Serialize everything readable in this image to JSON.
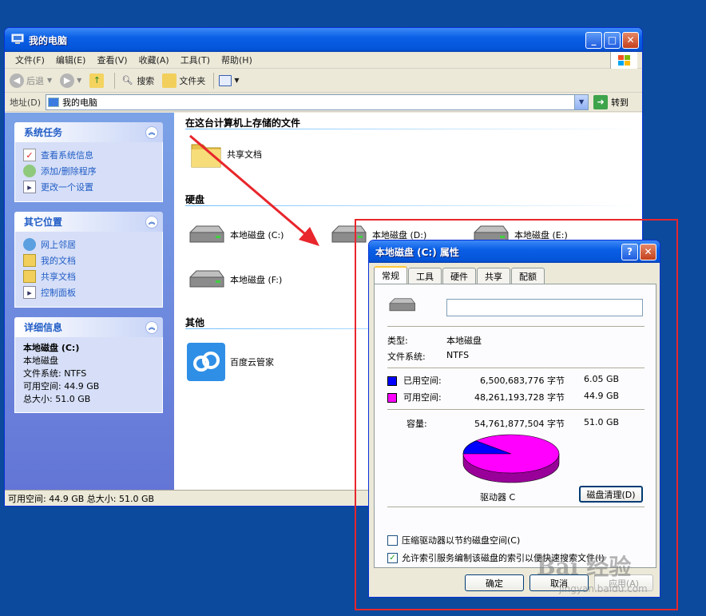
{
  "window": {
    "title": "我的电脑",
    "menu": [
      "文件(F)",
      "编辑(E)",
      "查看(V)",
      "收藏(A)",
      "工具(T)",
      "帮助(H)"
    ],
    "toolbar": {
      "back": "后退",
      "search": "搜索",
      "folders": "文件夹"
    },
    "address": {
      "label": "地址(D)",
      "value": "我的电脑",
      "go": "转到"
    },
    "status": "可用空间: 44.9 GB 总大小: 51.0 GB"
  },
  "sidebar": {
    "system_tasks": {
      "title": "系统任务",
      "items": [
        "查看系统信息",
        "添加/删除程序",
        "更改一个设置"
      ]
    },
    "other_places": {
      "title": "其它位置",
      "items": [
        "网上邻居",
        "我的文档",
        "共享文档",
        "控制面板"
      ]
    },
    "details": {
      "title": "详细信息",
      "name": "本地磁盘 (C:)",
      "type": "本地磁盘",
      "fs": "文件系统: NTFS",
      "free": "可用空间: 44.9 GB",
      "total": "总大小: 51.0 GB"
    }
  },
  "main": {
    "sections": {
      "stored": "在这台计算机上存储的文件",
      "hdd": "硬盘",
      "other": "其他"
    },
    "shared_docs": "共享文档",
    "drives": [
      "本地磁盘 (C:)",
      "本地磁盘 (D:)",
      "本地磁盘 (E:)",
      "本地磁盘 (F:)"
    ],
    "baidu": "百度云管家"
  },
  "dialog": {
    "title": "本地磁盘 (C:) 属性",
    "tabs": [
      "常规",
      "工具",
      "硬件",
      "共享",
      "配额"
    ],
    "type_label": "类型:",
    "type_value": "本地磁盘",
    "fs_label": "文件系统:",
    "fs_value": "NTFS",
    "used_label": "已用空间:",
    "used_bytes": "6,500,683,776 字节",
    "used_gb": "6.05 GB",
    "free_label": "可用空间:",
    "free_bytes": "48,261,193,728 字节",
    "free_gb": "44.9 GB",
    "cap_label": "容量:",
    "cap_bytes": "54,761,877,504 字节",
    "cap_gb": "51.0 GB",
    "drive_label": "驱动器 C",
    "cleanup": "磁盘清理(D)",
    "compress": "压缩驱动器以节约磁盘空间(C)",
    "index": "允许索引服务编制该磁盘的索引以便快速搜索文件(I)",
    "ok": "确定",
    "cancel": "取消",
    "apply": "应用(A)",
    "used_fraction": 0.119
  },
  "colors": {
    "used": "#0000ff",
    "free": "#ff00ff",
    "highlight": "#e8262c"
  },
  "watermark": {
    "main": "Bai 经验",
    "sub": "jingyan.baidu.com"
  }
}
